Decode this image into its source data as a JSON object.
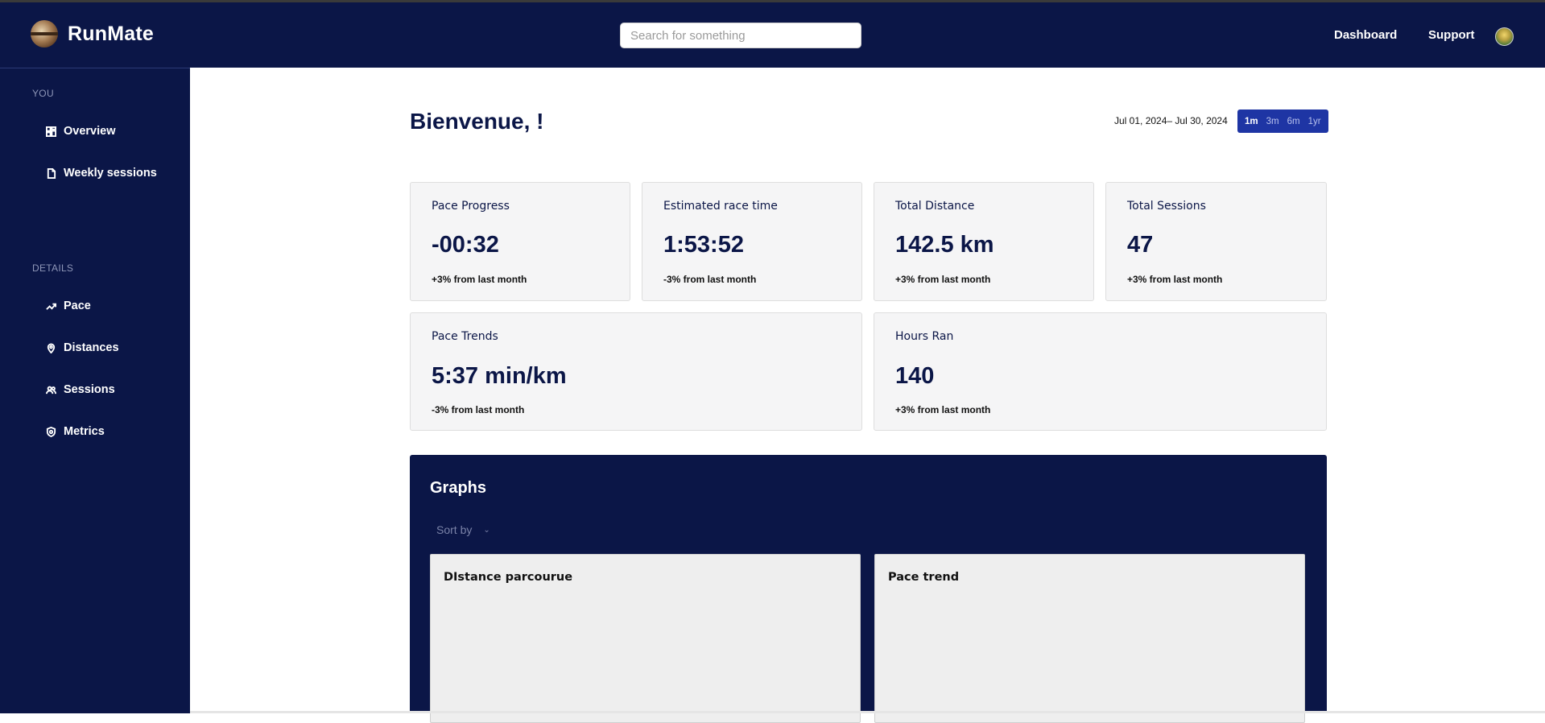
{
  "header": {
    "app_name": "RunMate",
    "search_placeholder": "Search for something",
    "nav": [
      "Dashboard",
      "Support"
    ]
  },
  "sidebar": {
    "sections": [
      {
        "label": "YOU",
        "items": [
          {
            "label": "Overview",
            "icon": "grid-icon"
          },
          {
            "label": "Weekly sessions",
            "icon": "document-icon"
          }
        ]
      },
      {
        "label": "DETAILS",
        "items": [
          {
            "label": "Pace",
            "icon": "trend-icon"
          },
          {
            "label": "Distances",
            "icon": "location-pin-icon"
          },
          {
            "label": "Sessions",
            "icon": "users-icon"
          },
          {
            "label": "Metrics",
            "icon": "shield-icon"
          }
        ]
      }
    ]
  },
  "main": {
    "title": "Bienvenue,  !",
    "date_range": "Jul 01, 2024– Jul 30, 2024",
    "periods": [
      "1m",
      "3m",
      "6m",
      "1yr"
    ],
    "selected_period": "1m",
    "stats": [
      {
        "label": "Pace Progress",
        "value": "-00:32",
        "sub": "+3% from last month"
      },
      {
        "label": "Estimated race time",
        "value": "1:53:52",
        "sub": "-3% from last month"
      },
      {
        "label": "Total Distance",
        "value": "142.5 km",
        "sub": "+3% from last month"
      },
      {
        "label": "Total Sessions",
        "value": "47",
        "sub": "+3% from last month"
      },
      {
        "label": "Pace Trends",
        "value": "5:37 min/km",
        "sub": "-3% from last month"
      },
      {
        "label": "Hours Ran",
        "value": "140",
        "sub": "+3% from last month"
      }
    ],
    "graphs": {
      "title": "Graphs",
      "sort_label": "Sort by",
      "panels": [
        {
          "title": "DIstance parcourue"
        },
        {
          "title": "Pace trend"
        }
      ]
    }
  },
  "colors": {
    "navy": "#0b1647",
    "accent": "#1e35a4",
    "card_bg": "#f5f5f6"
  }
}
